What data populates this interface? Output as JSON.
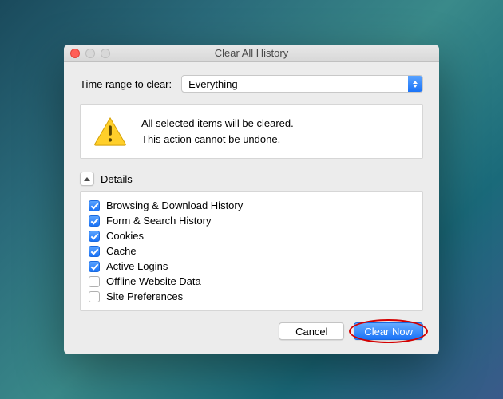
{
  "window": {
    "title": "Clear All History"
  },
  "range": {
    "label": "Time range to clear:",
    "selected": "Everything"
  },
  "warning": {
    "line1": "All selected items will be cleared.",
    "line2": "This action cannot be undone."
  },
  "details": {
    "label": "Details",
    "expanded": true
  },
  "checklist": [
    {
      "label": "Browsing & Download History",
      "checked": true
    },
    {
      "label": "Form & Search History",
      "checked": true
    },
    {
      "label": "Cookies",
      "checked": true
    },
    {
      "label": "Cache",
      "checked": true
    },
    {
      "label": "Active Logins",
      "checked": true
    },
    {
      "label": "Offline Website Data",
      "checked": false
    },
    {
      "label": "Site Preferences",
      "checked": false
    }
  ],
  "buttons": {
    "cancel": "Cancel",
    "clear": "Clear Now"
  },
  "annotation": {
    "highlight_target": "clear-now-button"
  }
}
